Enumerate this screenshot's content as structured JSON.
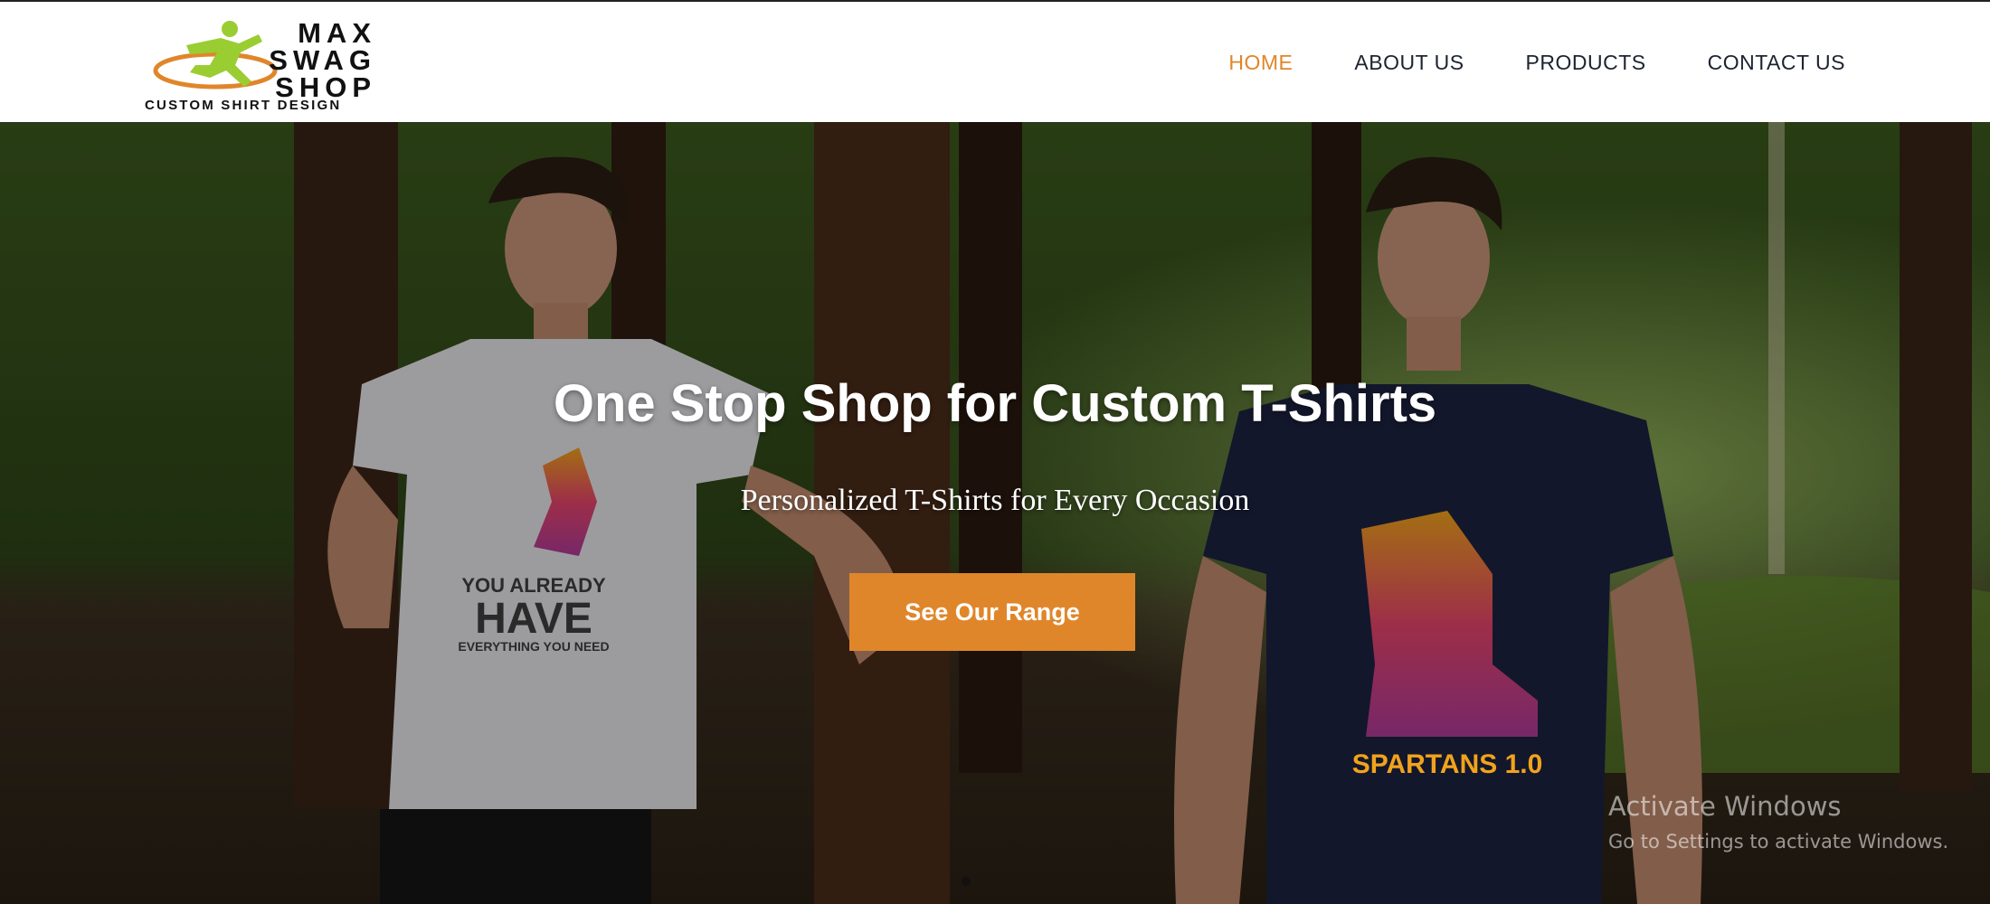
{
  "brand": {
    "word_line1": "MAX",
    "word_line2": "SWAG",
    "word_line3": "SHOP",
    "tagline": "CUSTOM SHIRT DESIGN",
    "logo_color": "#9acd32",
    "swoosh_color": "#e0862a"
  },
  "nav": {
    "items": [
      {
        "label": "HOME",
        "active": true
      },
      {
        "label": "ABOUT US",
        "active": false
      },
      {
        "label": "PRODUCTS",
        "active": false
      },
      {
        "label": "CONTACT US",
        "active": false
      }
    ]
  },
  "hero": {
    "title": "One Stop Shop for Custom T-Shirts",
    "subtitle": "Personalized T-Shirts for Every Occasion",
    "cta_label": "See Our Range",
    "accent_color": "#e0862a",
    "left_shirt_text_1": "YOU ALREADY",
    "left_shirt_text_2": "HAVE",
    "left_shirt_text_3": "EVERYTHING YOU NEED",
    "right_shirt_text": "SPARTANS 1.0"
  },
  "windows_watermark": {
    "title": "Activate Windows",
    "subtitle": "Go to Settings to activate Windows."
  }
}
